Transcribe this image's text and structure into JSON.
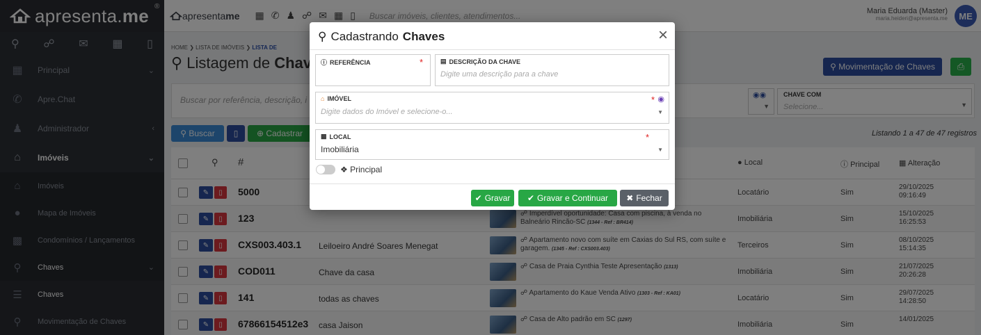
{
  "sidebar": {
    "brand_prefix": "apresenta",
    "brand_suffix": "me",
    "brand_reg": "®",
    "items": [
      {
        "label": "Principal",
        "icon": "grid-icon"
      },
      {
        "label": "Apre.Chat",
        "icon": "whatsapp-icon"
      },
      {
        "label": "Administrador",
        "icon": "users-icon"
      },
      {
        "label": "Imóveis",
        "icon": "home-icon"
      },
      {
        "label": "Imóveis",
        "icon": "home-icon"
      },
      {
        "label": "Mapa de Imóveis",
        "icon": "map-marker-icon"
      },
      {
        "label": "Condomínios / Lançamentos",
        "icon": "building-icon"
      },
      {
        "label": "Chaves",
        "icon": "key-icon"
      },
      {
        "label": "Chaves",
        "icon": "list-icon"
      },
      {
        "label": "Movimentação de Chaves",
        "icon": "key-icon"
      }
    ]
  },
  "topbar": {
    "logo_prefix": "apresenta",
    "logo_suffix": "me",
    "search_placeholder": "Buscar imóveis, clientes, atendimentos...",
    "user_name": "Maria Eduarda (Master)",
    "user_email": "maria.heideri@apresenta.me",
    "avatar_initials": "ME"
  },
  "page": {
    "breadcrumb_home": "HOME",
    "breadcrumb_list": "LISTA DE IMÓVEIS",
    "breadcrumb_current": "LISTA DE",
    "title_prefix": "Listagem de",
    "title_bold": "Chaves",
    "mov_button": "Movimentação de Chaves",
    "search_placeholder": "Buscar por referência, descrição, i",
    "chave_com_label": "CHAVE COM",
    "chave_com_placeholder": "Selecione...",
    "buscar": "Buscar",
    "cadastrar": "Cadastrar",
    "listing": "Listando 1 a 47 de 47 registros"
  },
  "table": {
    "headers": {
      "hash": "#",
      "local": "Local",
      "principal": "Principal",
      "alteracao": "Alteração"
    },
    "rows": [
      {
        "ref": "5000",
        "desc": "",
        "imovel": "",
        "imovel_ref": "",
        "local": "Locatário",
        "principal": "Sim",
        "date": "29/10/2025",
        "time": "09:16:49"
      },
      {
        "ref": "123",
        "desc": "",
        "imovel": "Imperdível oportunidade: Casa com piscina, à venda no Balneário Rincão-SC",
        "imovel_ref": "(1344 - Ref : BR414)",
        "local": "Imobiliária",
        "principal": "Sim",
        "date": "15/10/2025",
        "time": "16:25:53"
      },
      {
        "ref": "CXS003.403.1",
        "desc": "Leiloeiro André Soares Menegat",
        "imovel": "Apartamento novo com suíte em Caxias do Sul RS, com suíte e garagem.",
        "imovel_ref": "(1345 - Ref : CXS003.403)",
        "local": "Terceiros",
        "principal": "Sim",
        "date": "08/10/2025",
        "time": "15:14:35"
      },
      {
        "ref": "COD011",
        "desc": "Chave da casa",
        "imovel": "Casa de Praia Cynthia Teste Apresentação",
        "imovel_ref": "(1313)",
        "local": "Imobiliária",
        "principal": "Sim",
        "date": "21/07/2025",
        "time": "20:26:28"
      },
      {
        "ref": "141",
        "desc": "todas as chaves",
        "imovel": "Apartamento do Kaue Venda Ativo",
        "imovel_ref": "(1303 - Ref : KA01)",
        "local": "Locatário",
        "principal": "Sim",
        "date": "29/07/2025",
        "time": "14:28:50"
      },
      {
        "ref": "67866154512e3",
        "desc": "casa Jaison",
        "imovel": "Casa de Alto padrão em SC",
        "imovel_ref": "(1297)",
        "local": "Imobiliária",
        "principal": "Sim",
        "date": "14/01/2025",
        "time": ""
      }
    ]
  },
  "modal": {
    "title_prefix": "Cadastrando",
    "title_bold": "Chaves",
    "close": "×",
    "ref_label": "REFERÊNCIA",
    "desc_label": "DESCRIÇÃO DA CHAVE",
    "desc_placeholder": "Digite uma descrição para a chave",
    "imovel_label": "IMÓVEL",
    "imovel_placeholder": "Digite dados do Imóvel e selecione-o...",
    "local_label": "LOCAL",
    "local_value": "Imobiliária",
    "principal_label": "Principal",
    "btn_gravar": "Gravar",
    "btn_gravar_continuar": "Gravar e Continuar",
    "btn_fechar": "Fechar",
    "required_mark": "*"
  },
  "colors": {
    "primary": "#2c4d9e",
    "success": "#28a745",
    "danger": "#d9363e",
    "sidebar": "#2d3037"
  }
}
